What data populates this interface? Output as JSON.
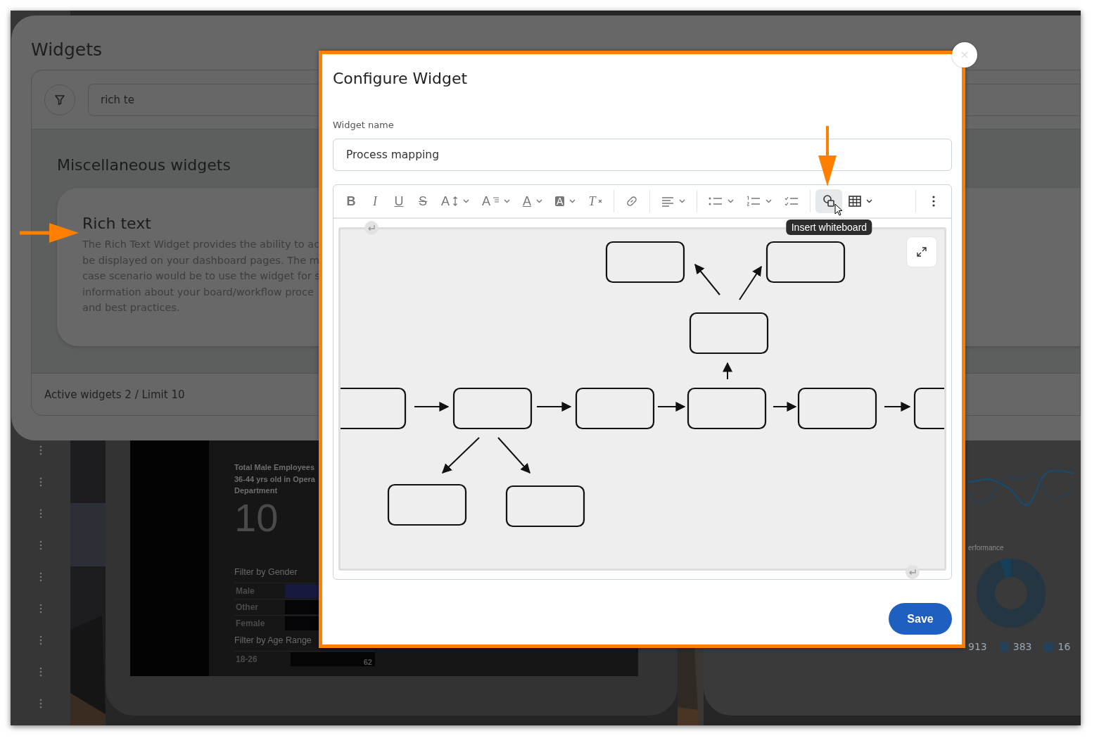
{
  "widgets_panel": {
    "title": "Widgets",
    "search": {
      "value": "rich te"
    },
    "section_title": "Miscellaneous widgets",
    "widget_card": {
      "title": "Rich text",
      "description_lines": [
        "The Rich Text Widget provides the ability to ac",
        "be displayed on your dashboard pages. The m",
        "case scenario would be to use the widget for s",
        "information about your board/workflow proce",
        "and best practices."
      ]
    },
    "footer": "Active widgets 2 / Limit 10"
  },
  "dashboard_card": {
    "title_lines": [
      "Total Male Employees",
      "36-44 yrs old in Opera",
      "Department"
    ],
    "value": "10",
    "gender_filter": {
      "title": "Filter by Gender",
      "rows": [
        {
          "label": "Male",
          "color": "#17193f"
        },
        {
          "label": "Other",
          "color": "#050508"
        },
        {
          "label": "Female",
          "color": "#050508"
        }
      ]
    },
    "age_filter": {
      "title": "Filter by Age Range",
      "rows": [
        {
          "label": "18-26",
          "count": "62"
        }
      ]
    }
  },
  "analytics_card": {
    "section_label": "erformance",
    "stats": [
      "913",
      "383",
      "16"
    ]
  },
  "modal": {
    "title": "Configure Widget",
    "field": {
      "label": "Widget name",
      "value": "Process mapping"
    },
    "toolbar": {
      "groups": [
        [
          {
            "kind": "bold",
            "glyph": "B",
            "dropdown": false,
            "selected": false
          },
          {
            "kind": "italic",
            "glyph": "I",
            "dropdown": false,
            "selected": false
          },
          {
            "kind": "underline",
            "glyph": "U",
            "dropdown": false,
            "selected": false
          },
          {
            "kind": "strike",
            "glyph": "S",
            "dropdown": false,
            "selected": false
          },
          {
            "kind": "font-size",
            "glyph": "A",
            "dropdown": true,
            "selected": false
          },
          {
            "kind": "line-height",
            "glyph": "A",
            "dropdown": true,
            "selected": false
          },
          {
            "kind": "text-color",
            "glyph": "A",
            "dropdown": true,
            "selected": false
          },
          {
            "kind": "highlight",
            "glyph": "A",
            "dropdown": true,
            "selected": false
          },
          {
            "kind": "clear",
            "glyph": "T",
            "dropdown": false,
            "selected": false
          }
        ],
        [
          {
            "kind": "link",
            "dropdown": false,
            "selected": false
          }
        ],
        [
          {
            "kind": "align",
            "dropdown": true,
            "selected": false
          }
        ],
        [
          {
            "kind": "bullets",
            "dropdown": true,
            "selected": false
          },
          {
            "kind": "numbered",
            "dropdown": true,
            "selected": false
          },
          {
            "kind": "checklist",
            "dropdown": false,
            "selected": false
          }
        ],
        [
          {
            "kind": "whiteboard",
            "dropdown": false,
            "selected": true,
            "tooltip": "Insert whiteboard"
          },
          {
            "kind": "table",
            "dropdown": true,
            "selected": false
          }
        ],
        [
          {
            "kind": "more",
            "dropdown": false,
            "selected": false
          }
        ]
      ]
    },
    "save_label": "Save"
  }
}
